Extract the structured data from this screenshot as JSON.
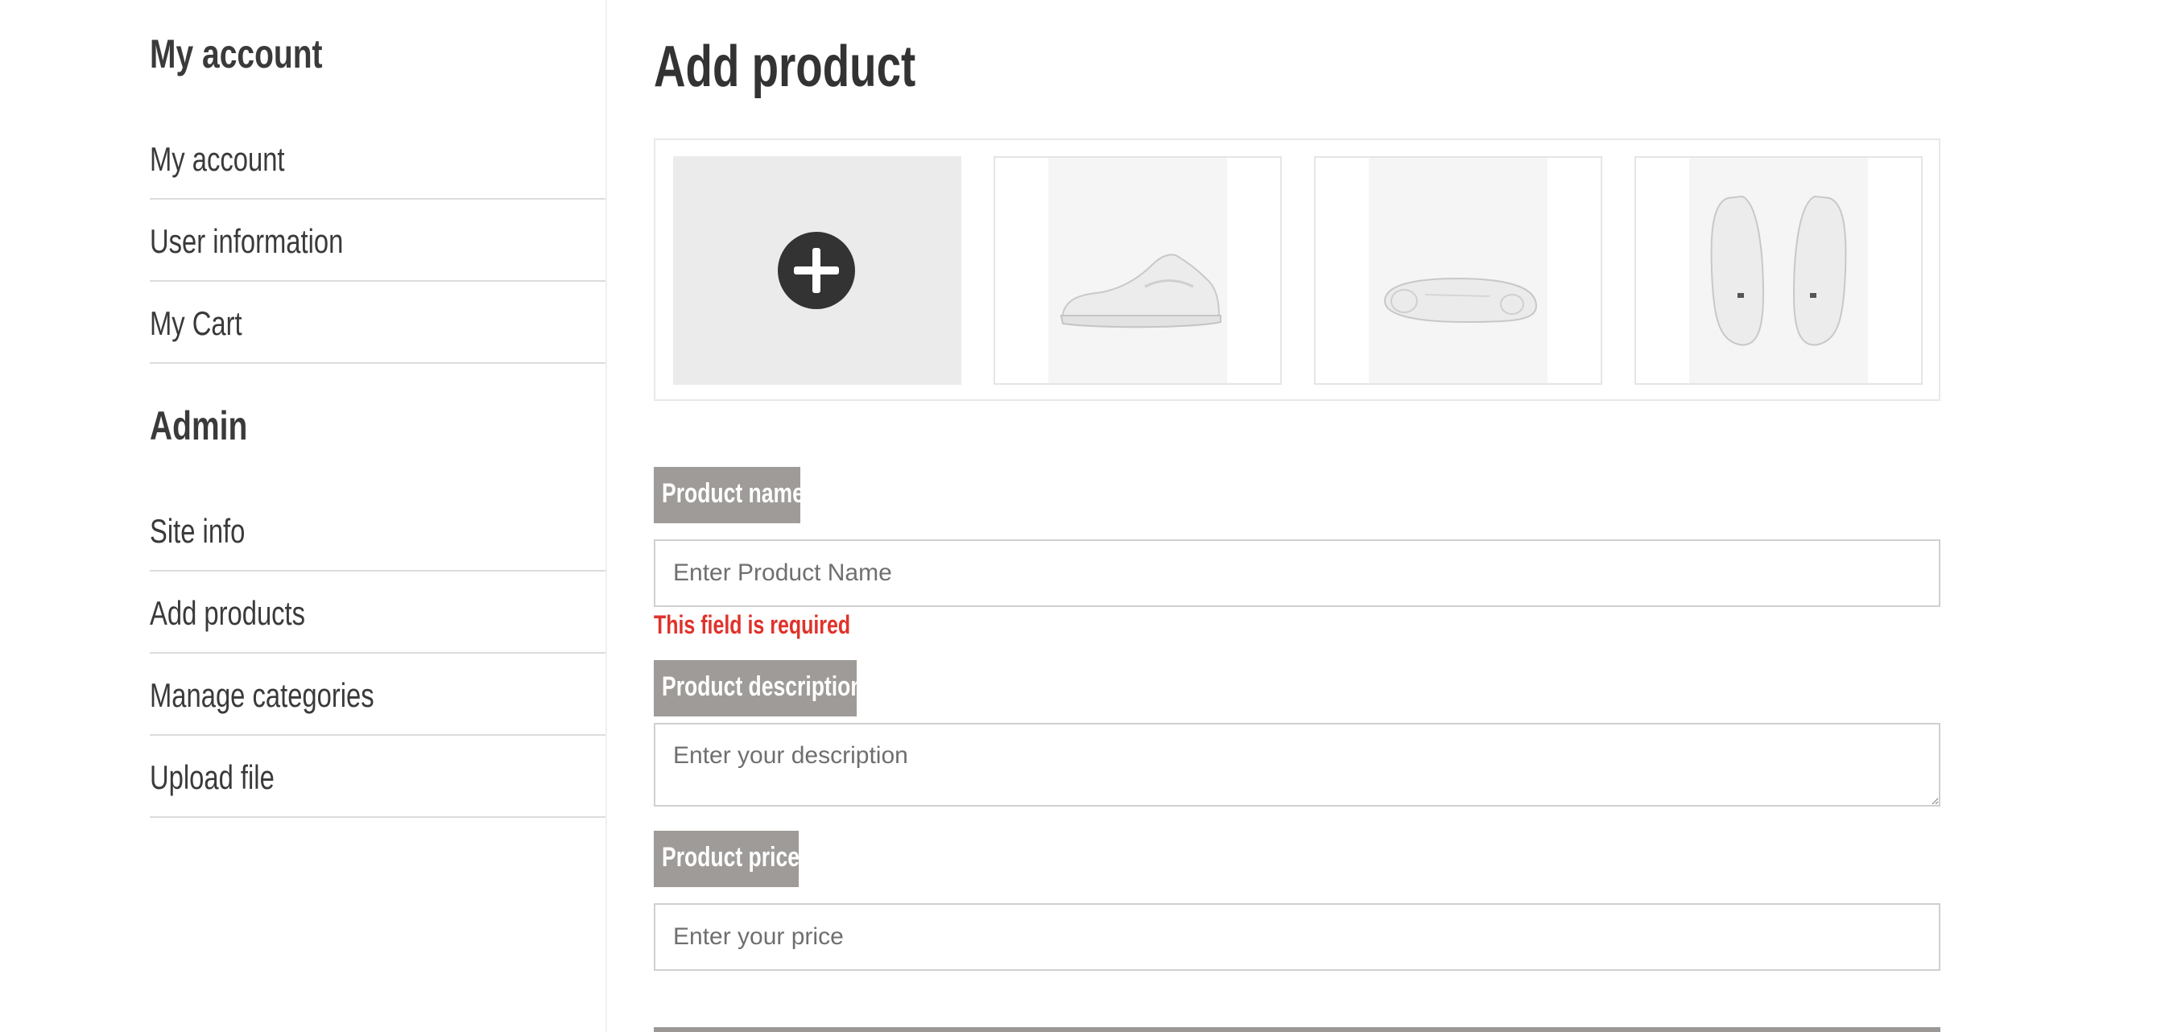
{
  "sidebar": {
    "account_heading": "My account",
    "account_items": [
      {
        "label": "My account"
      },
      {
        "label": "User information"
      },
      {
        "label": "My Cart"
      }
    ],
    "admin_heading": "Admin",
    "admin_items": [
      {
        "label": "Site info"
      },
      {
        "label": "Add products"
      },
      {
        "label": "Manage categories"
      },
      {
        "label": "Upload file"
      }
    ]
  },
  "main": {
    "title": "Add product",
    "gallery": {
      "add_icon": "plus-circle-icon",
      "images": [
        "sneaker-side-view",
        "sneaker-sole-view",
        "sneaker-top-view"
      ]
    },
    "form": {
      "name_label": "Product name",
      "name_placeholder": "Enter Product Name",
      "name_error": "This field is required",
      "description_label": "Product description",
      "description_placeholder": "Enter your description",
      "price_label": "Product price",
      "price_placeholder": "Enter your price"
    }
  },
  "colors": {
    "label_bg": "#9e9b98",
    "error": "#e0322b",
    "text": "#333333"
  }
}
